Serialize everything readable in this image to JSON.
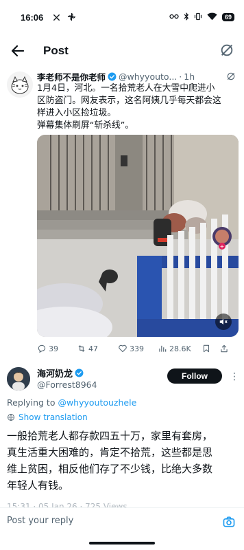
{
  "status_bar": {
    "time": "16:06",
    "left_icons": [
      "x-logo-icon",
      "pinwheel-icon"
    ],
    "right_icons": [
      "link-icon",
      "bluetooth-icon",
      "vibrate-icon",
      "wifi-icon"
    ],
    "battery": "69"
  },
  "header": {
    "title": "Post",
    "back_icon": "arrow-left-icon",
    "right_icon": "grok-icon"
  },
  "quoted_post": {
    "author_name": "李老师不是你老师",
    "author_handle": "@whyyouto...",
    "time": "1h",
    "text_lines": [
      "1月4日，河北。一名拾荒老人在大雪中爬进小",
      "区防盗门。网友表示，这名阿姨几乎每天都会这",
      "样进入小区捡垃圾。",
      "弹幕集体刷屏“斩杀线”。"
    ],
    "stats": {
      "replies": "39",
      "reposts": "47",
      "likes": "339",
      "views": "28.6K"
    }
  },
  "reply": {
    "author_name": "海河奶龙",
    "author_handle": "@Forrest8964",
    "follow_label": "Follow",
    "replying_prefix": "Replying to ",
    "replying_to": "@whyyoutouzhele",
    "show_translation": "Show translation",
    "text_lines": [
      "一般拾荒老人都存款四五十万，家里有套房，",
      "真生活重大困难的，肯定不拾荒，这些都是思",
      "维上贫困，相反他们存了不少钱，比绝大多数",
      "年轻人有钱。"
    ],
    "meta_partial": "15:31 · 05 Jan 26 · 725 Views"
  },
  "composer": {
    "placeholder": "Post your reply"
  },
  "colors": {
    "accent": "#1d9bf0",
    "text": "#0f1419",
    "muted": "#536471",
    "follow_bg": "#0f1419"
  }
}
